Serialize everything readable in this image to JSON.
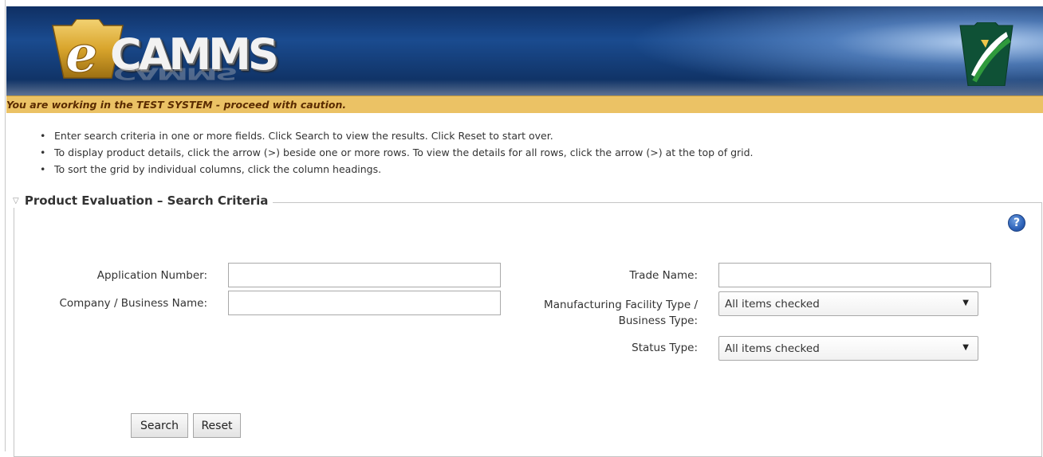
{
  "header": {
    "logo_text": "CAMMS",
    "logo_reflection": "CAMMS",
    "logo_name": "eCAMMS"
  },
  "warning": {
    "text": "You are working in the TEST SYSTEM - proceed with caution."
  },
  "instructions": [
    "Enter search criteria in one or more fields. Click Search to view the results. Click Reset to start over.",
    "To display product details, click the arrow (>) beside one or more rows. To view the details for all rows, click the arrow (>) at the top of grid.",
    "To sort the grid by individual columns, click the column headings."
  ],
  "bullet": "•",
  "search_section": {
    "title": "Product Evaluation – Search Criteria",
    "collapse_glyph": "▽",
    "help_glyph": "?"
  },
  "form": {
    "application_number": {
      "label": "Application Number:",
      "value": ""
    },
    "company_name": {
      "label": "Company / Business Name:",
      "value": ""
    },
    "trade_name": {
      "label": "Trade Name:",
      "value": ""
    },
    "facility_type": {
      "label_line1": "Manufacturing Facility Type /",
      "label_line2": "Business Type:",
      "selected": "All items checked"
    },
    "status_type": {
      "label": "Status Type:",
      "selected": "All items checked"
    }
  },
  "dropdown_glyph": "▼",
  "buttons": {
    "search": "Search",
    "reset": "Reset"
  },
  "colors": {
    "header_blue": "#1a4b8f",
    "warning_bg": "#ebc265",
    "warning_text": "#5a2b00",
    "logo_gold": "#d9a52c",
    "pa_green": "#2f9a3c"
  }
}
